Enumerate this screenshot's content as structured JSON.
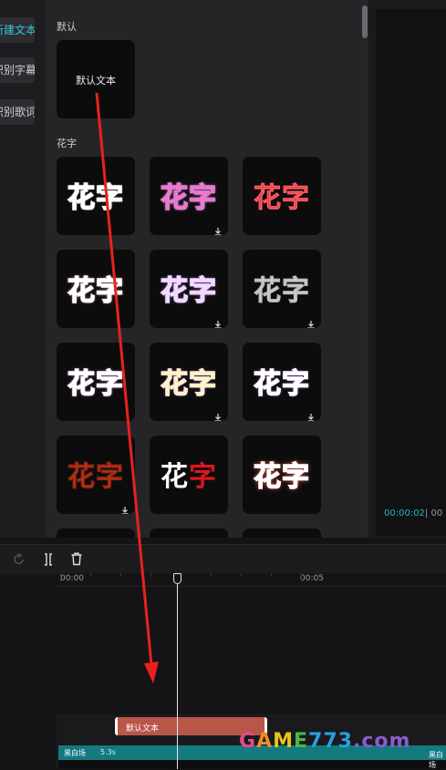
{
  "left_tabs": [
    {
      "label": "新建文本",
      "active": true
    },
    {
      "label": "识别字幕",
      "active": false
    },
    {
      "label": "识别歌词",
      "active": false
    }
  ],
  "sections": {
    "default_title": "默认",
    "default_card_label": "默认文本",
    "fancy_title": "花字"
  },
  "fancy_text": "花字",
  "fancy_presets": [
    {
      "style": "pink-white",
      "downloadable": false
    },
    {
      "style": "white-pink",
      "downloadable": true
    },
    {
      "style": "red-glitter",
      "downloadable": false
    },
    {
      "style": "pink-outline",
      "downloadable": false
    },
    {
      "style": "purple-glitter",
      "downloadable": true
    },
    {
      "style": "white-glitter",
      "downloadable": true
    },
    {
      "style": "rainbow",
      "downloadable": false
    },
    {
      "style": "orange-purple",
      "downloadable": true
    },
    {
      "style": "gold-purple",
      "downloadable": true
    },
    {
      "style": "orange-red",
      "downloadable": true
    },
    {
      "style": "white-red",
      "downloadable": false
    },
    {
      "style": "coral-glow",
      "downloadable": false
    }
  ],
  "preview": {
    "current_time": "00:00:02",
    "separator": "| 00"
  },
  "timeline": {
    "ruler_labels": [
      "00:00",
      "00:05"
    ],
    "text_clip_label": "默认文本",
    "video_clip_label": "黑白场",
    "video_clip_duration": "5.3s",
    "video_clip_label_2": "黑白场"
  },
  "watermark": {
    "text": "GAME773.com"
  },
  "colors": {
    "accent": "#2fc9d6",
    "text_clip": "#b85648",
    "video_clip": "#137a80",
    "arrow": "#e8221b"
  }
}
